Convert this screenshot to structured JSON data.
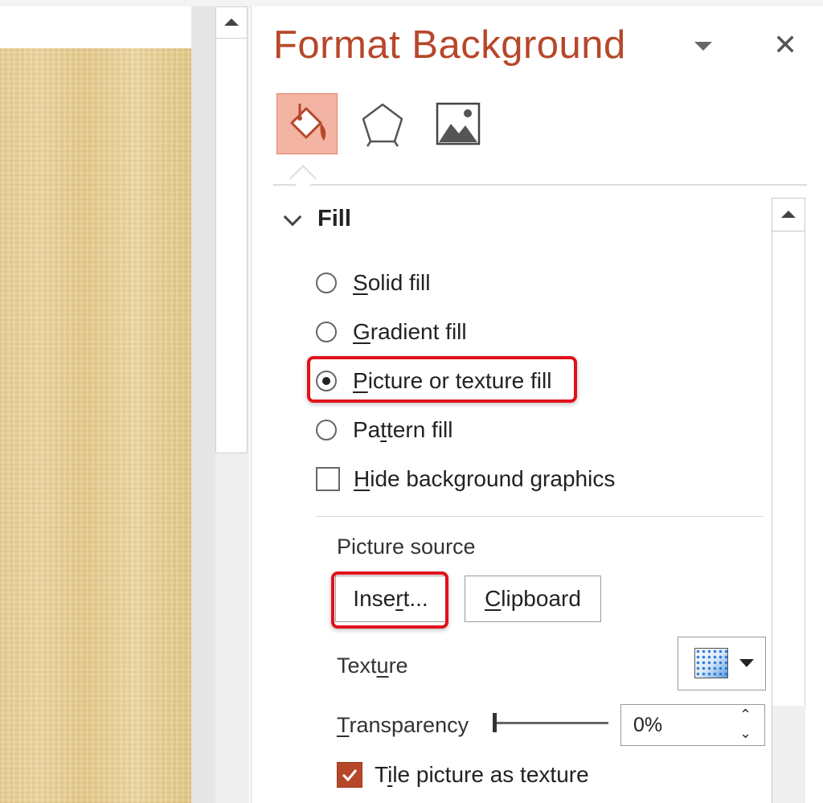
{
  "panel": {
    "title": "Format Background",
    "close_symbol": "✕",
    "tabs": [
      {
        "name": "fill-tab",
        "icon": "paint-bucket-icon",
        "selected": true
      },
      {
        "name": "effects-tab",
        "icon": "pentagon-icon",
        "selected": false
      },
      {
        "name": "picture-tab",
        "icon": "picture-icon",
        "selected": false
      }
    ]
  },
  "fill": {
    "header": "Fill",
    "options": [
      {
        "pre": "",
        "key": "S",
        "post": "olid fill",
        "selected": false
      },
      {
        "pre": "",
        "key": "G",
        "post": "radient fill",
        "selected": false
      },
      {
        "pre": "",
        "key": "P",
        "post": "icture or texture fill",
        "selected": true
      },
      {
        "pre": "Pa",
        "key": "t",
        "post": "tern fill",
        "selected": false
      }
    ],
    "hide_graphics": {
      "pre": "",
      "key": "H",
      "post": "ide background graphics",
      "checked": false
    },
    "picture_source_label": "Picture source",
    "insert_button": {
      "pre": "Inse",
      "key": "r",
      "post": "t..."
    },
    "clipboard_button": {
      "pre": "",
      "key": "C",
      "post": "lipboard"
    },
    "texture_label": {
      "pre": "Text",
      "key": "u",
      "post": "re"
    },
    "transparency_label": {
      "pre": "",
      "key": "T",
      "post": "ransparency"
    },
    "transparency_value": "0%",
    "tile": {
      "pre": "T",
      "key": "i",
      "post": "le picture as texture",
      "checked": true
    }
  },
  "colors": {
    "accent": "#b7472a",
    "selected_tab_bg": "#f3b4a4",
    "highlight_annotation": "#e0121a"
  }
}
